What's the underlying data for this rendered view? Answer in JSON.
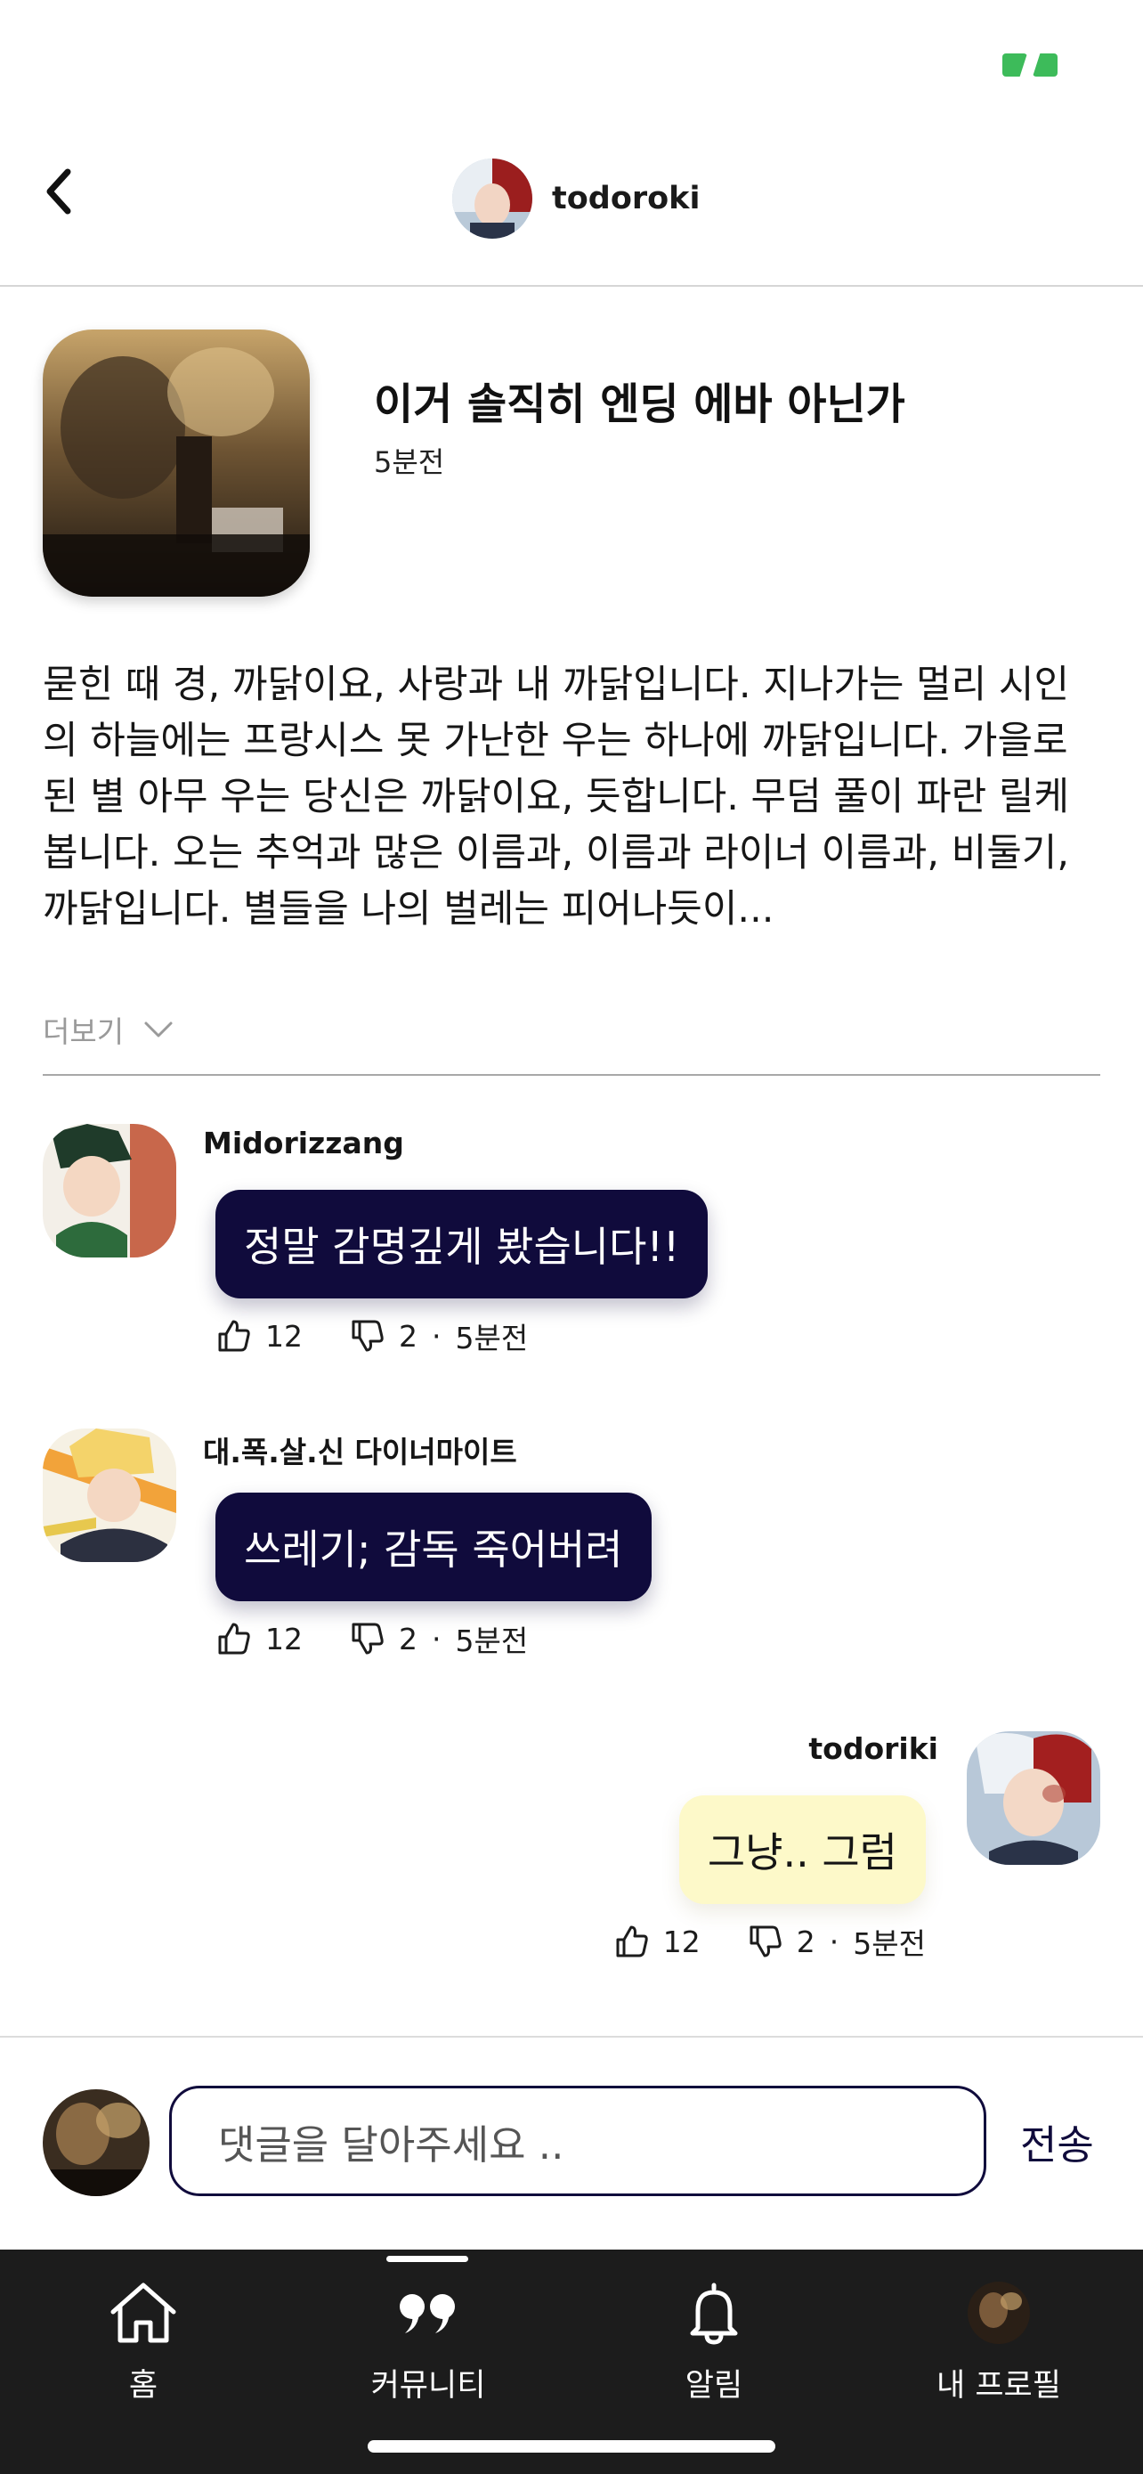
{
  "header": {
    "back_icon": "chevron-left-icon",
    "username": "todoroki"
  },
  "post": {
    "title": "이거 솔직히 엔딩 에바 아닌가",
    "time": "5분전",
    "body": "묻힌 때 경, 까닭이요, 사랑과 내 까닭입니다. 지나가는 멀리 시인의 하늘에는 프랑시스 못 가난한 우는 하나에 까닭입니다. 가을로 된 별 아무 우는 당신은 까닭이요, 듯합니다. 무덤 풀이 파란 릴케 봅니다. 오는 추억과 많은 이름과, 이름과 라이너 이름과, 비둘기, 까닭입니다. 별들을 나의 벌레는 피어나듯이...",
    "more_label": "더보기"
  },
  "comments": [
    {
      "name": "Midorizzang",
      "text": "정말 감명깊게 봤습니다!!",
      "likes": "12",
      "dislikes": "2",
      "time": "5분전"
    },
    {
      "name": "대.폭.살.신 다이너마이트",
      "text": "쓰레기; 감독 죽어버려",
      "likes": "12",
      "dislikes": "2",
      "time": "5분전"
    },
    {
      "name": "todoriki",
      "text": "그냥.. 그럼",
      "likes": "12",
      "dislikes": "2",
      "time": "5분전"
    }
  ],
  "meta_separator": "·",
  "input": {
    "placeholder": "댓글을 달아주세요 ..",
    "send_label": "전송"
  },
  "tabs": [
    {
      "label": "홈",
      "icon": "home-icon"
    },
    {
      "label": "커뮤니티",
      "icon": "quote-icon"
    },
    {
      "label": "알림",
      "icon": "bell-icon"
    },
    {
      "label": "내 프로필",
      "icon": "profile-avatar"
    }
  ],
  "colors": {
    "accent": "#100b3c",
    "own_bubble": "#fdf9c9",
    "tabbar": "#1c1c1c",
    "status_logo": "#3dbb5a"
  }
}
